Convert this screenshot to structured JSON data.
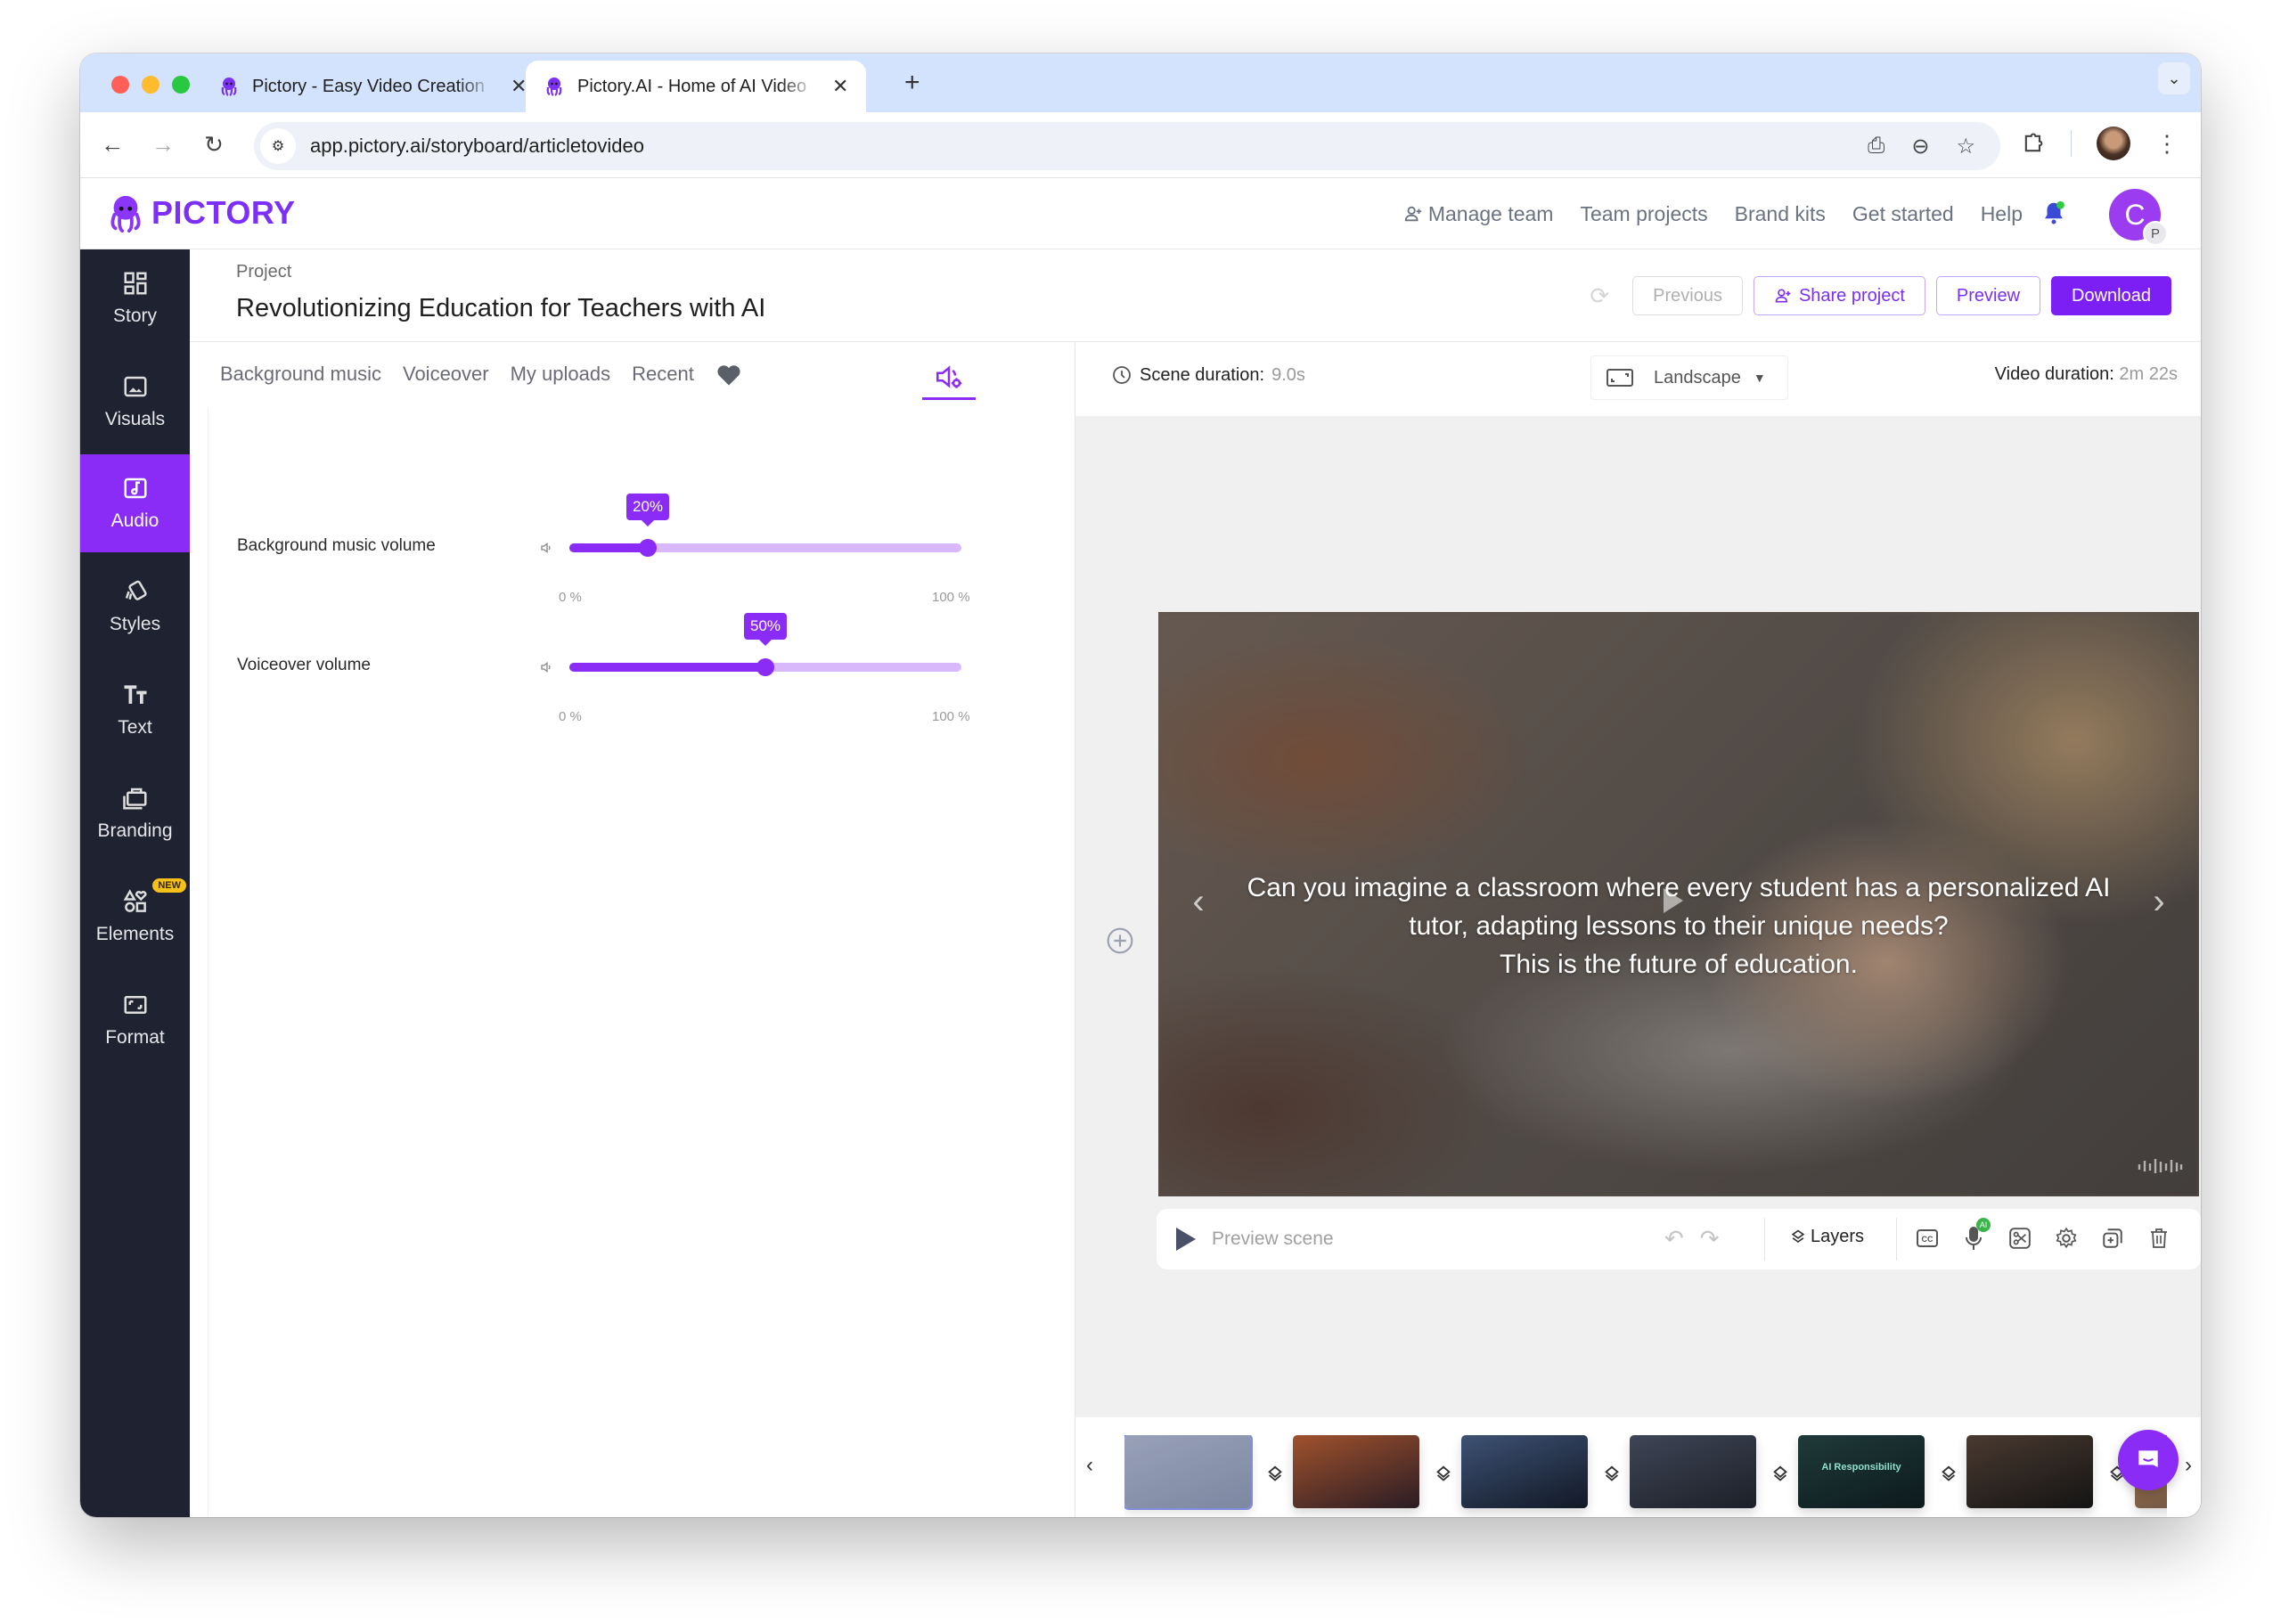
{
  "browser": {
    "tabs": [
      {
        "title": "Pictory - Easy Video Creation",
        "active": false
      },
      {
        "title": "Pictory.AI - Home of AI Video",
        "active": true
      }
    ],
    "url": "app.pictory.ai/storyboard/articletovideo",
    "traffic_colors": [
      "#ff5f57",
      "#febc2e",
      "#28c840"
    ]
  },
  "app": {
    "brand": "PICTORY",
    "brand_color": "#7b2ff7",
    "nav": [
      "Manage team",
      "Team projects",
      "Brand kits",
      "Get started",
      "Help"
    ],
    "user_initial": "C",
    "user_sub_initial": "P"
  },
  "sidebar": {
    "items": [
      {
        "label": "Story",
        "icon": "grid-icon"
      },
      {
        "label": "Visuals",
        "icon": "image-icon"
      },
      {
        "label": "Audio",
        "icon": "music-icon",
        "active": true
      },
      {
        "label": "Styles",
        "icon": "styles-icon"
      },
      {
        "label": "Text",
        "icon": "text-icon"
      },
      {
        "label": "Branding",
        "icon": "briefcase-icon"
      },
      {
        "label": "Elements",
        "icon": "shapes-icon",
        "badge": "NEW"
      },
      {
        "label": "Format",
        "icon": "format-icon"
      }
    ]
  },
  "project": {
    "label": "Project",
    "title": "Revolutionizing Education for Teachers with AI",
    "buttons": {
      "previous": "Previous",
      "share": "Share project",
      "preview": "Preview",
      "download": "Download"
    }
  },
  "audio_panel": {
    "tabs": [
      "Background music",
      "Voiceover",
      "My uploads",
      "Recent"
    ],
    "volumes": [
      {
        "label": "Background music volume",
        "value": 20,
        "display": "20%",
        "min": "0 %",
        "max": "100 %"
      },
      {
        "label": "Voiceover volume",
        "value": 50,
        "display": "50%",
        "min": "0 %",
        "max": "100 %"
      }
    ]
  },
  "editor": {
    "scene_duration_label": "Scene duration:",
    "scene_duration": "9.0s",
    "orientation": "Landscape",
    "video_duration_label": "Video duration:",
    "video_duration": "2m 22s",
    "caption_lines": [
      "Can you imagine a classroom where every student has a personalized AI",
      "tutor, adapting lessons to their unique needs?",
      "This is the future of education."
    ],
    "controls": {
      "preview_scene": "Preview scene",
      "layers": "Layers",
      "ai_badge": "AI"
    }
  },
  "scenes": [
    {
      "label": "Scene 1",
      "active": true,
      "colors": [
        "#7f8aa8",
        "#5d6a8a"
      ]
    },
    {
      "label": "Scene 2",
      "colors": [
        "#a0522d",
        "#2a1c24"
      ]
    },
    {
      "label": "Scene 3",
      "colors": [
        "#3d5274",
        "#121826"
      ]
    },
    {
      "label": "Scene 4",
      "colors": [
        "#3e4556",
        "#1d2028"
      ]
    },
    {
      "label": "Scene 5",
      "colors": [
        "#1f3a3a",
        "#0d1a1c"
      ],
      "overlay": "AI Responsibility"
    },
    {
      "label": "Scene 6",
      "colors": [
        "#4a3a30",
        "#141414"
      ]
    },
    {
      "label": "Scene 7",
      "colors": [
        "#b38050",
        "#5a4a40"
      ]
    }
  ]
}
